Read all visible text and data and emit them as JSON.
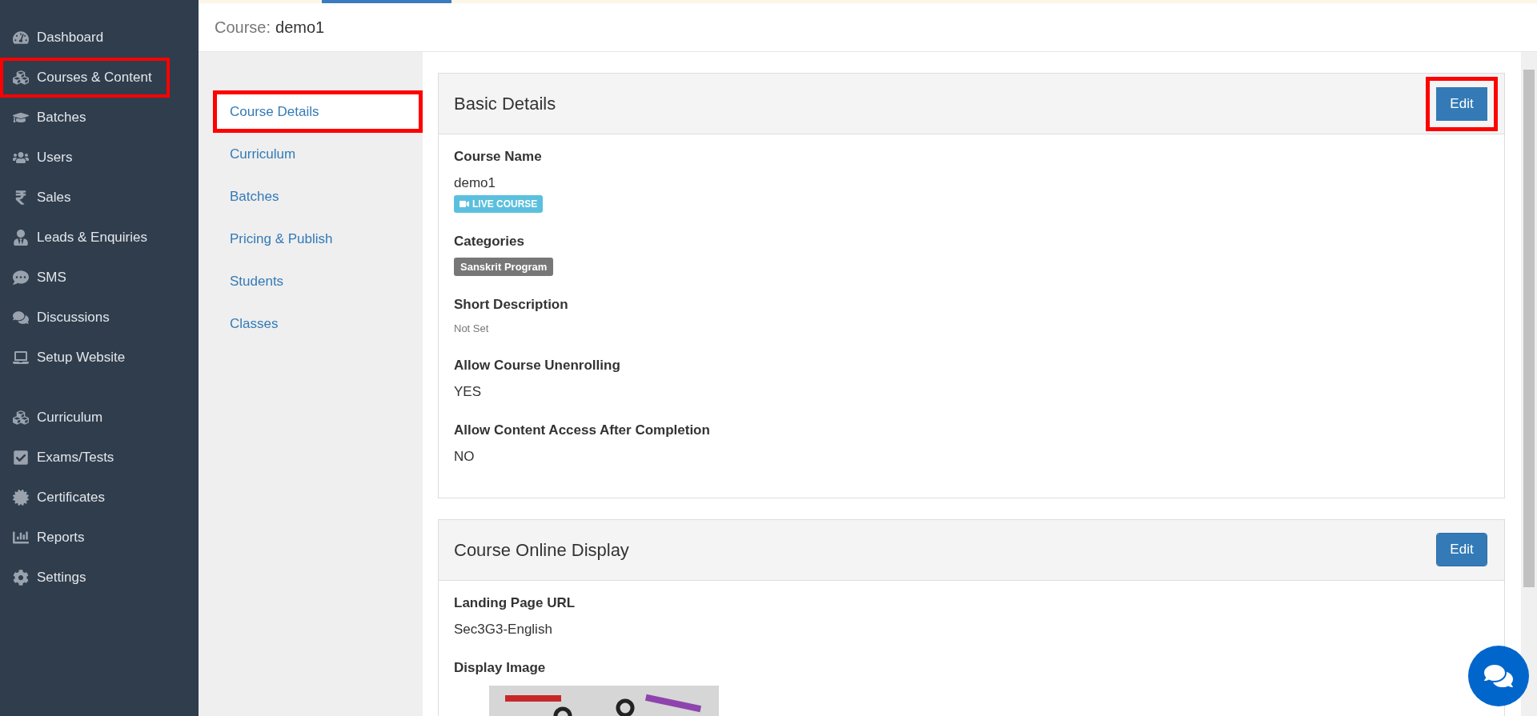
{
  "sidebar": {
    "groups": [
      [
        {
          "label": "Dashboard",
          "highlighted": false
        },
        {
          "label": "Courses & Content",
          "highlighted": true
        },
        {
          "label": "Batches",
          "highlighted": false
        },
        {
          "label": "Users",
          "highlighted": false
        },
        {
          "label": "Sales",
          "highlighted": false
        },
        {
          "label": "Leads & Enquiries",
          "highlighted": false
        },
        {
          "label": "SMS",
          "highlighted": false
        },
        {
          "label": "Discussions",
          "highlighted": false
        },
        {
          "label": "Setup Website",
          "highlighted": false
        }
      ],
      [
        {
          "label": "Curriculum",
          "highlighted": false
        },
        {
          "label": "Exams/Tests",
          "highlighted": false
        },
        {
          "label": "Certificates",
          "highlighted": false
        },
        {
          "label": "Reports",
          "highlighted": false
        },
        {
          "label": "Settings",
          "highlighted": false
        }
      ]
    ]
  },
  "header": {
    "prefix": "Course:",
    "title": "demo1"
  },
  "subnav": [
    {
      "label": "Course Details",
      "selected": true,
      "highlighted": true
    },
    {
      "label": "Curriculum",
      "selected": false,
      "highlighted": false
    },
    {
      "label": "Batches",
      "selected": false,
      "highlighted": false
    },
    {
      "label": "Pricing & Publish",
      "selected": false,
      "highlighted": false
    },
    {
      "label": "Students",
      "selected": false,
      "highlighted": false
    },
    {
      "label": "Classes",
      "selected": false,
      "highlighted": false
    }
  ],
  "panels": [
    {
      "title": "Basic Details",
      "button": "Edit",
      "highlighted": true,
      "fields": [
        {
          "label": "Course Name",
          "kind": "text",
          "value": "demo1",
          "badge": "LIVE COURSE"
        },
        {
          "label": "Categories",
          "kind": "tag",
          "value": "Sanskrit Program"
        },
        {
          "label": "Short Description",
          "kind": "muted",
          "value": "Not Set"
        },
        {
          "label": "Allow Course Unenrolling",
          "kind": "text",
          "value": "YES"
        },
        {
          "label": "Allow Content Access After Completion",
          "kind": "text",
          "value": "NO"
        }
      ]
    },
    {
      "title": "Course Online Display",
      "button": "Edit",
      "highlighted": false,
      "fields": [
        {
          "label": "Landing Page URL",
          "kind": "text",
          "value": "Sec3G3-English"
        },
        {
          "label": "Display Image",
          "kind": "picture"
        }
      ]
    }
  ]
}
